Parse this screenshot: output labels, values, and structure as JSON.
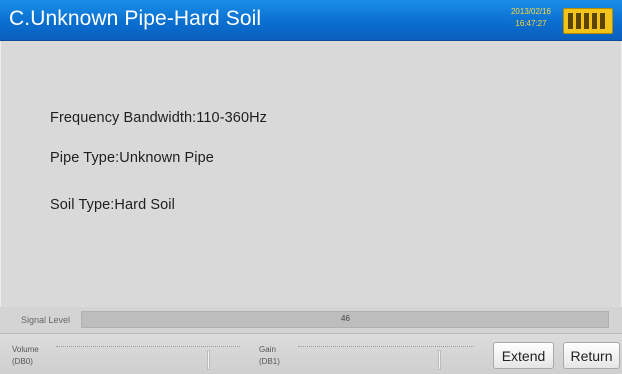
{
  "header": {
    "title": "C.Unknown Pipe-Hard Soil",
    "date": "2013/02/16",
    "time": "16:47:27",
    "battery_icon": "battery-icon",
    "accent_color": "#0a6fd0"
  },
  "info": {
    "frequency": "Frequency Bandwidth:110-360Hz",
    "pipe_type": "Pipe Type:Unknown Pipe",
    "soil_type": "Soil Type:Hard Soil"
  },
  "signal": {
    "label": "Signal Level",
    "value": "46"
  },
  "controls": {
    "volume_label": "Volume",
    "volume_unit": "(DB0)",
    "gain_label": "Gain",
    "gain_unit": "(DB1)",
    "extend_label": "Extend",
    "return_label": "Return"
  }
}
